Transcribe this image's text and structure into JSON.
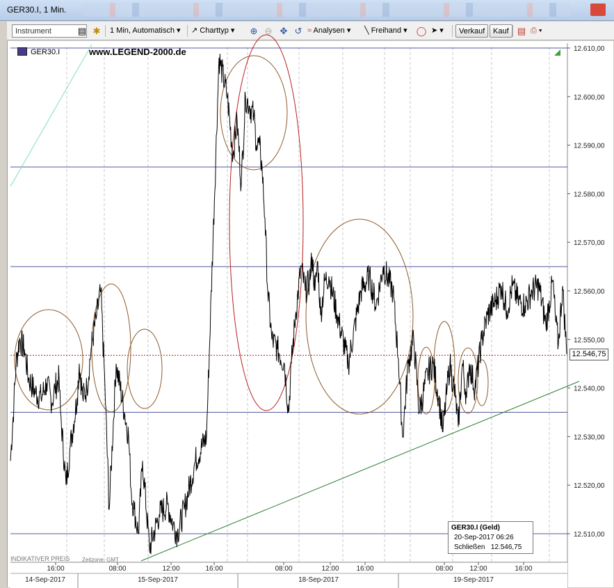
{
  "window": {
    "title": "GER30.I, 1 Min."
  },
  "toolbar": {
    "instrument_placeholder": "Instrument",
    "interval_label": "1 Min,  Automatisch",
    "charttype_label": "Charttyp",
    "analysen_label": "Analysen",
    "freihand_label": "Freihand",
    "verkauf_label": "Verkauf",
    "kauf_label": "Kauf"
  },
  "chart": {
    "symbol": "GER30.I",
    "brand": "www.LEGEND-2000.de",
    "footer_price": "INDIKATIVER PREIS",
    "footer_timezone": "Zeitzone: GMT",
    "current_price_label": "12.546,75",
    "info_box": {
      "title": "GER30.I (Geld)",
      "datetime": "20-Sep-2017 06:26",
      "close_label": "Schließen",
      "close_value": "12.546,75"
    },
    "colors": {
      "price_line": "#000000",
      "horizontal_lines": "#1a237e",
      "trendline": "#2e7d32",
      "ellipse_brown": "#8b5a2b",
      "ellipse_red": "#b71c1c",
      "current_line": "#c62828"
    }
  },
  "chart_data": {
    "type": "line",
    "series": [
      {
        "name": "GER30.I",
        "x": [
          0,
          5,
          8,
          13,
          20,
          26,
          36,
          44,
          52,
          60,
          64,
          70,
          72,
          80,
          86,
          96,
          99,
          104,
          110,
          116,
          124,
          130,
          136,
          142,
          152,
          164,
          170,
          174,
          178,
          184,
          190,
          200,
          214,
          226,
          234,
          240,
          250,
          266,
          282,
          300,
          312,
          320,
          326,
          332,
          338,
          344,
          350,
          354,
          358,
          362,
          366,
          370,
          376,
          384,
          394,
          400,
          404,
          410,
          418,
          424,
          430,
          434,
          438,
          442,
          446,
          452,
          458,
          470,
          486,
          504,
          516,
          526,
          536,
          550,
          558,
          564,
          572,
          580,
          588,
          600,
          608,
          616,
          622,
          628,
          632,
          640,
          644,
          650,
          656,
          660,
          668,
          678,
          686,
          698,
          706,
          714,
          722,
          730,
          740,
          750,
          760,
          770,
          780,
          784,
          788,
          794,
          800
        ],
        "y": [
          12525,
          12537,
          12545,
          12550,
          12548,
          12542,
          12539,
          12538,
          12541,
          12537,
          12540,
          12542,
          12535,
          12520,
          12528,
          12538,
          12545,
          12538,
          12540,
          12548,
          12555,
          12560,
          12540,
          12515,
          12545,
          12535,
          12530,
          12518,
          12515,
          12510,
          12525,
          12507,
          12514,
          12516,
          12512,
          12510,
          12515,
          12525,
          12530,
          12608,
          12600,
          12588,
          12595,
          12582,
          12600,
          12598,
          12596,
          12590,
          12590,
          12585,
          12575,
          12560,
          12550,
          12548,
          12545,
          12535,
          12545,
          12555,
          12565,
          12560,
          12562,
          12567,
          12560,
          12566,
          12555,
          12562,
          12563,
          12555,
          12545,
          12560,
          12563,
          12557,
          12565,
          12560,
          12546,
          12530,
          12545,
          12550,
          12535,
          12543,
          12545,
          12538,
          12531,
          12540,
          12545,
          12538,
          12532,
          12545,
          12538,
          12545,
          12540,
          12550,
          12555,
          12558,
          12561,
          12556,
          12561,
          12558,
          12557,
          12560,
          12561,
          12553,
          12562,
          12554,
          12549,
          12561,
          12547
        ]
      }
    ],
    "title": "GER30.I, 1 Min.",
    "ylim": [
      12503,
      12612
    ],
    "y_ticks": [
      "12.510,00",
      "12.520,00",
      "12.530,00",
      "12.540,00",
      "12.550,00",
      "12.560,00",
      "12.570,00",
      "12.580,00",
      "12.590,00",
      "12.600,00",
      "12.610,00"
    ],
    "x_tick_labels": [
      "16:00",
      "08:00",
      "12:00",
      "16:00",
      "08:00",
      "12:00",
      "16:00",
      "08:00",
      "12:00",
      "16:00"
    ],
    "date_labels": [
      "14-Sep-2017",
      "15-Sep-2017",
      "18-Sep-2017",
      "19-Sep-2017"
    ],
    "horizontal_levels": [
      12610,
      12585.5,
      12565,
      12535,
      12510
    ],
    "current_price": 12546.75,
    "legend": "bottom-right",
    "grid": true
  }
}
